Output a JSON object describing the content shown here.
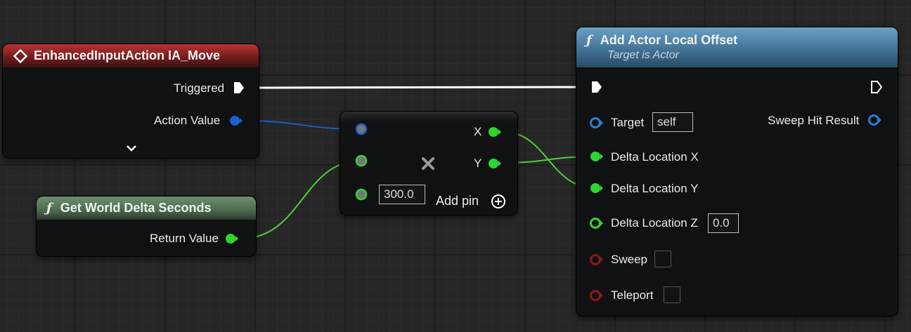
{
  "input_action_node": {
    "title": "EnhancedInputAction IA_Move",
    "triggered_label": "Triggered",
    "action_value_label": "Action Value",
    "expand_icon": "chevron-down-icon"
  },
  "delta_seconds_node": {
    "title": "Get World Delta Seconds",
    "return_value_label": "Return Value"
  },
  "multiply_node": {
    "operator_icon": "multiply-icon",
    "out_x_label": "X",
    "out_y_label": "Y",
    "constant_value": "300.0",
    "add_pin_label": "Add pin"
  },
  "add_offset_node": {
    "title": "Add Actor Local Offset",
    "subtitle": "Target is Actor",
    "target_label": "Target",
    "target_value": "self",
    "sweep_hit_label": "Sweep Hit Result",
    "delta_x_label": "Delta Location X",
    "delta_y_label": "Delta Location Y",
    "delta_z_label": "Delta Location Z",
    "delta_z_value": "0.0",
    "sweep_label": "Sweep",
    "teleport_label": "Teleport"
  },
  "colors": {
    "exec": "#ffffff",
    "vector2d": "#1a5fd0",
    "float": "#2fd52f",
    "bool": "#8a1a1a",
    "object": "#2a7fd0",
    "wire_float": "#4ecf3a",
    "wire_vector": "#1b5ec4"
  }
}
